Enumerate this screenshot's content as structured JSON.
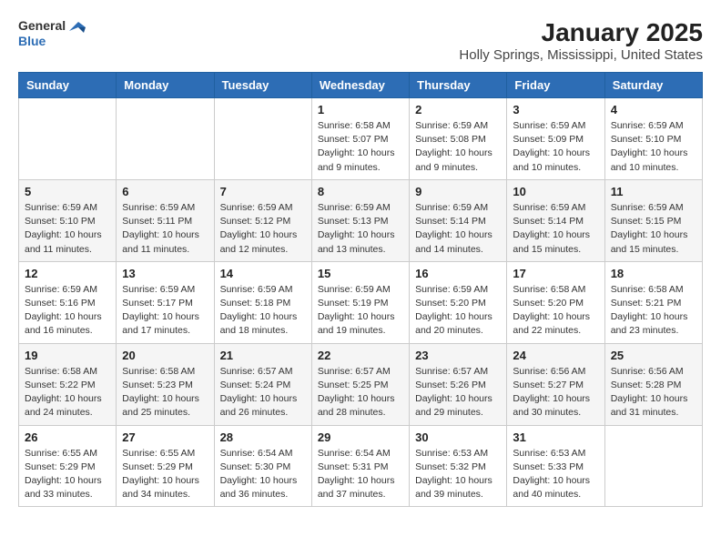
{
  "header": {
    "logo_line1": "General",
    "logo_line2": "Blue",
    "title": "January 2025",
    "subtitle": "Holly Springs, Mississippi, United States"
  },
  "weekdays": [
    "Sunday",
    "Monday",
    "Tuesday",
    "Wednesday",
    "Thursday",
    "Friday",
    "Saturday"
  ],
  "weeks": [
    [
      {
        "day": "",
        "sunrise": "",
        "sunset": "",
        "daylight": ""
      },
      {
        "day": "",
        "sunrise": "",
        "sunset": "",
        "daylight": ""
      },
      {
        "day": "",
        "sunrise": "",
        "sunset": "",
        "daylight": ""
      },
      {
        "day": "1",
        "sunrise": "Sunrise: 6:58 AM",
        "sunset": "Sunset: 5:07 PM",
        "daylight": "Daylight: 10 hours and 9 minutes."
      },
      {
        "day": "2",
        "sunrise": "Sunrise: 6:59 AM",
        "sunset": "Sunset: 5:08 PM",
        "daylight": "Daylight: 10 hours and 9 minutes."
      },
      {
        "day": "3",
        "sunrise": "Sunrise: 6:59 AM",
        "sunset": "Sunset: 5:09 PM",
        "daylight": "Daylight: 10 hours and 10 minutes."
      },
      {
        "day": "4",
        "sunrise": "Sunrise: 6:59 AM",
        "sunset": "Sunset: 5:10 PM",
        "daylight": "Daylight: 10 hours and 10 minutes."
      }
    ],
    [
      {
        "day": "5",
        "sunrise": "Sunrise: 6:59 AM",
        "sunset": "Sunset: 5:10 PM",
        "daylight": "Daylight: 10 hours and 11 minutes."
      },
      {
        "day": "6",
        "sunrise": "Sunrise: 6:59 AM",
        "sunset": "Sunset: 5:11 PM",
        "daylight": "Daylight: 10 hours and 11 minutes."
      },
      {
        "day": "7",
        "sunrise": "Sunrise: 6:59 AM",
        "sunset": "Sunset: 5:12 PM",
        "daylight": "Daylight: 10 hours and 12 minutes."
      },
      {
        "day": "8",
        "sunrise": "Sunrise: 6:59 AM",
        "sunset": "Sunset: 5:13 PM",
        "daylight": "Daylight: 10 hours and 13 minutes."
      },
      {
        "day": "9",
        "sunrise": "Sunrise: 6:59 AM",
        "sunset": "Sunset: 5:14 PM",
        "daylight": "Daylight: 10 hours and 14 minutes."
      },
      {
        "day": "10",
        "sunrise": "Sunrise: 6:59 AM",
        "sunset": "Sunset: 5:14 PM",
        "daylight": "Daylight: 10 hours and 15 minutes."
      },
      {
        "day": "11",
        "sunrise": "Sunrise: 6:59 AM",
        "sunset": "Sunset: 5:15 PM",
        "daylight": "Daylight: 10 hours and 15 minutes."
      }
    ],
    [
      {
        "day": "12",
        "sunrise": "Sunrise: 6:59 AM",
        "sunset": "Sunset: 5:16 PM",
        "daylight": "Daylight: 10 hours and 16 minutes."
      },
      {
        "day": "13",
        "sunrise": "Sunrise: 6:59 AM",
        "sunset": "Sunset: 5:17 PM",
        "daylight": "Daylight: 10 hours and 17 minutes."
      },
      {
        "day": "14",
        "sunrise": "Sunrise: 6:59 AM",
        "sunset": "Sunset: 5:18 PM",
        "daylight": "Daylight: 10 hours and 18 minutes."
      },
      {
        "day": "15",
        "sunrise": "Sunrise: 6:59 AM",
        "sunset": "Sunset: 5:19 PM",
        "daylight": "Daylight: 10 hours and 19 minutes."
      },
      {
        "day": "16",
        "sunrise": "Sunrise: 6:59 AM",
        "sunset": "Sunset: 5:20 PM",
        "daylight": "Daylight: 10 hours and 20 minutes."
      },
      {
        "day": "17",
        "sunrise": "Sunrise: 6:58 AM",
        "sunset": "Sunset: 5:20 PM",
        "daylight": "Daylight: 10 hours and 22 minutes."
      },
      {
        "day": "18",
        "sunrise": "Sunrise: 6:58 AM",
        "sunset": "Sunset: 5:21 PM",
        "daylight": "Daylight: 10 hours and 23 minutes."
      }
    ],
    [
      {
        "day": "19",
        "sunrise": "Sunrise: 6:58 AM",
        "sunset": "Sunset: 5:22 PM",
        "daylight": "Daylight: 10 hours and 24 minutes."
      },
      {
        "day": "20",
        "sunrise": "Sunrise: 6:58 AM",
        "sunset": "Sunset: 5:23 PM",
        "daylight": "Daylight: 10 hours and 25 minutes."
      },
      {
        "day": "21",
        "sunrise": "Sunrise: 6:57 AM",
        "sunset": "Sunset: 5:24 PM",
        "daylight": "Daylight: 10 hours and 26 minutes."
      },
      {
        "day": "22",
        "sunrise": "Sunrise: 6:57 AM",
        "sunset": "Sunset: 5:25 PM",
        "daylight": "Daylight: 10 hours and 28 minutes."
      },
      {
        "day": "23",
        "sunrise": "Sunrise: 6:57 AM",
        "sunset": "Sunset: 5:26 PM",
        "daylight": "Daylight: 10 hours and 29 minutes."
      },
      {
        "day": "24",
        "sunrise": "Sunrise: 6:56 AM",
        "sunset": "Sunset: 5:27 PM",
        "daylight": "Daylight: 10 hours and 30 minutes."
      },
      {
        "day": "25",
        "sunrise": "Sunrise: 6:56 AM",
        "sunset": "Sunset: 5:28 PM",
        "daylight": "Daylight: 10 hours and 31 minutes."
      }
    ],
    [
      {
        "day": "26",
        "sunrise": "Sunrise: 6:55 AM",
        "sunset": "Sunset: 5:29 PM",
        "daylight": "Daylight: 10 hours and 33 minutes."
      },
      {
        "day": "27",
        "sunrise": "Sunrise: 6:55 AM",
        "sunset": "Sunset: 5:29 PM",
        "daylight": "Daylight: 10 hours and 34 minutes."
      },
      {
        "day": "28",
        "sunrise": "Sunrise: 6:54 AM",
        "sunset": "Sunset: 5:30 PM",
        "daylight": "Daylight: 10 hours and 36 minutes."
      },
      {
        "day": "29",
        "sunrise": "Sunrise: 6:54 AM",
        "sunset": "Sunset: 5:31 PM",
        "daylight": "Daylight: 10 hours and 37 minutes."
      },
      {
        "day": "30",
        "sunrise": "Sunrise: 6:53 AM",
        "sunset": "Sunset: 5:32 PM",
        "daylight": "Daylight: 10 hours and 39 minutes."
      },
      {
        "day": "31",
        "sunrise": "Sunrise: 6:53 AM",
        "sunset": "Sunset: 5:33 PM",
        "daylight": "Daylight: 10 hours and 40 minutes."
      },
      {
        "day": "",
        "sunrise": "",
        "sunset": "",
        "daylight": ""
      }
    ]
  ]
}
